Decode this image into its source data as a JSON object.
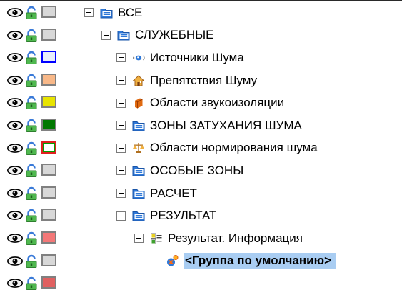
{
  "tree": {
    "rows": [
      {
        "label": "ВСЕ",
        "expander": "minus",
        "icon": "folder-icon",
        "swatch": {
          "fill": "#d8d8d8",
          "border": "#808080"
        }
      },
      {
        "label": "СЛУЖЕБНЫЕ",
        "expander": "minus",
        "icon": "folder-icon",
        "swatch": {
          "fill": "#d8d8d8",
          "border": "#808080"
        }
      },
      {
        "label": "Источники Шума",
        "expander": "plus",
        "icon": "noise-source-icon",
        "swatch": {
          "fill": "#e8eefc",
          "border": "#0000ff"
        }
      },
      {
        "label": "Препятствия Шуму",
        "expander": "plus",
        "icon": "house-icon",
        "swatch": {
          "fill": "#f8b888",
          "border": "#808080"
        }
      },
      {
        "label": "Области звукоизоляции",
        "expander": "plus",
        "icon": "soundproofing-icon",
        "swatch": {
          "fill": "#e8e400",
          "border": "#808080"
        }
      },
      {
        "label": "ЗОНЫ ЗАТУХАНИЯ ШУМА",
        "expander": "plus",
        "icon": "folder-icon",
        "swatch": {
          "fill": "#007800",
          "border": "#808080"
        }
      },
      {
        "label": "Области нормирования шума",
        "expander": "plus",
        "icon": "scales-icon",
        "swatch": {
          "fill": "#ffffff",
          "border": "#e02020",
          "inner": "#00a000"
        }
      },
      {
        "label": "ОСОБЫЕ ЗОНЫ",
        "expander": "plus",
        "icon": "folder-icon",
        "swatch": {
          "fill": "#d8d8d8",
          "border": "#808080"
        }
      },
      {
        "label": "РАСЧЕТ",
        "expander": "plus",
        "icon": "folder-icon",
        "swatch": {
          "fill": "#d8d8d8",
          "border": "#808080"
        }
      },
      {
        "label": "РЕЗУЛЬТАТ",
        "expander": "minus",
        "icon": "folder-icon",
        "swatch": {
          "fill": "#d8d8d8",
          "border": "#808080"
        }
      },
      {
        "label": "Результат. Информация",
        "expander": "minus",
        "icon": "result-info-icon",
        "swatch": {
          "fill": "#f47878",
          "border": "#808080"
        }
      },
      {
        "label": "<Группа по умолчанию>",
        "expander": "none",
        "icon": "default-group-icon",
        "swatch": {
          "fill": "#d8d8d8",
          "border": "#808080"
        },
        "selected": true
      },
      {
        "label": "",
        "expander": "none",
        "icon": "",
        "swatch": {
          "fill": "#e06060",
          "border": "#808080"
        },
        "partial": true
      }
    ]
  },
  "colors": {
    "selection": "#a9cdf2",
    "folder": "#2e78d8",
    "tree_line": "#7a7a7a"
  }
}
